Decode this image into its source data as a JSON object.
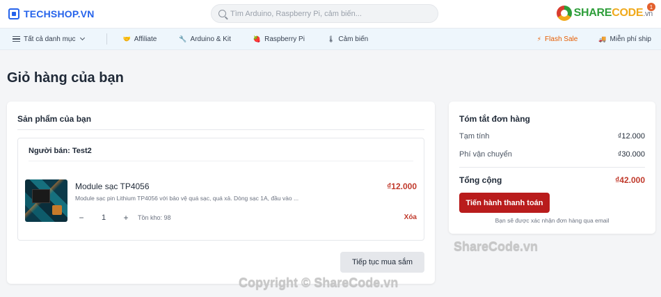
{
  "header": {
    "brand": "TECHSHOP.VN",
    "search_placeholder": "Tìm Arduino, Raspberry Pi, cảm biến...",
    "cart_count": "1",
    "watermark_logo": {
      "part1": "SHARE",
      "part2": "CODE",
      "part3": ".vn"
    }
  },
  "nav": {
    "all_categories": "Tất cả danh mục",
    "items": [
      {
        "label": "Affiliate",
        "icon": "handshake-icon"
      },
      {
        "label": "Arduino & Kit",
        "icon": "tool-icon"
      },
      {
        "label": "Raspberry Pi",
        "icon": "raspberry-icon"
      },
      {
        "label": "Cảm biến",
        "icon": "sensor-icon"
      }
    ],
    "flash_sale": "Flash Sale",
    "free_ship": "Miễn phí ship"
  },
  "page": {
    "title": "Giỏ hàng của bạn"
  },
  "products": {
    "title": "Sản phẩm của bạn",
    "seller_label": "Người bán: Test2",
    "items": [
      {
        "name": "Module sạc TP4056",
        "description": "Module sạc pin Lithium TP4056 với bảo vệ quá sạc, quá xả. Dòng sạc 1A, đầu vào ...",
        "quantity": "1",
        "stock": "Tồn kho: 98",
        "price": "₫12.000",
        "remove_label": "Xóa"
      }
    ],
    "continue_label": "Tiếp tục mua sắm"
  },
  "summary": {
    "title": "Tóm tắt đơn hàng",
    "subtotal_label": "Tạm tính",
    "subtotal_value": "₫12.000",
    "shipping_label": "Phí vận chuyển",
    "shipping_value": "₫30.000",
    "total_label": "Tổng cộng",
    "total_value": "₫42.000",
    "checkout_label": "Tiến hành thanh toán",
    "note": "Bạn sẽ được xác nhận đơn hàng qua email"
  },
  "watermarks": {
    "sharecode": "ShareCode.vn",
    "copyright": "Copyright © ShareCode.vn"
  },
  "colors": {
    "brand_blue": "#2563eb",
    "price_red": "#c0392b",
    "checkout_red": "#b91c1c",
    "flash_orange": "#e65c00"
  }
}
